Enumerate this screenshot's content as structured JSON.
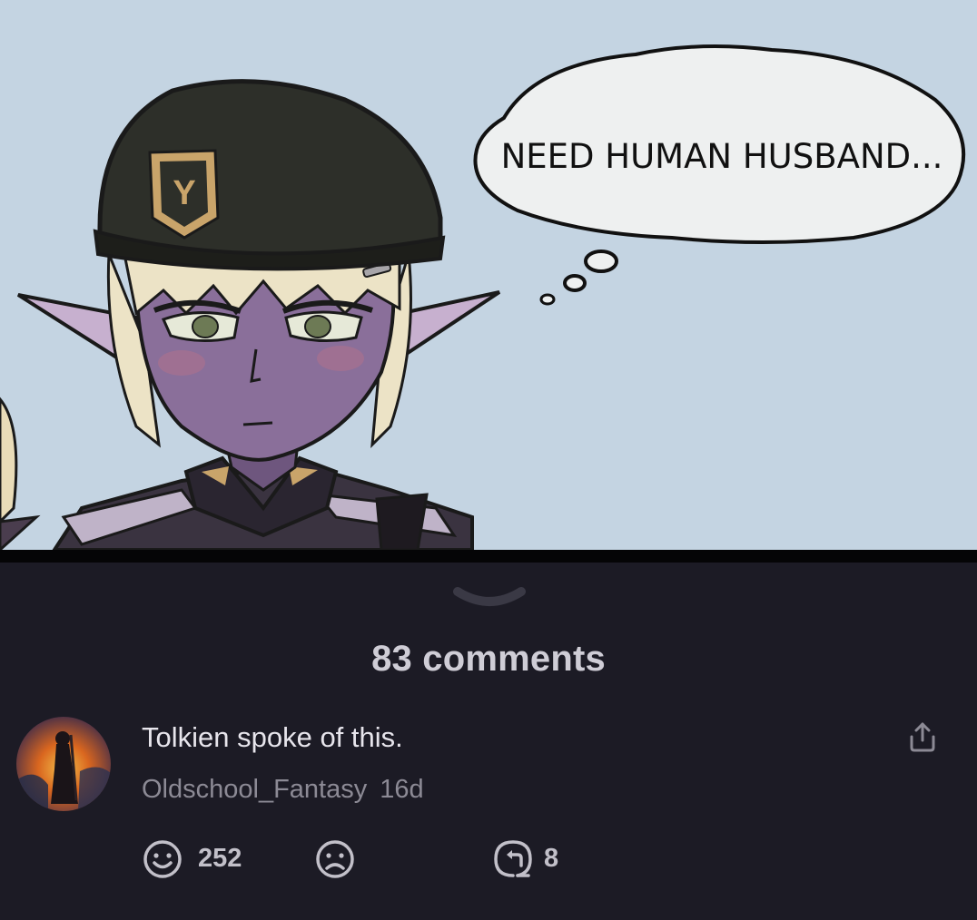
{
  "comic": {
    "thought_bubble_text": "NEED HUMAN HUSBAND..."
  },
  "comments": {
    "count_label": "83 comments"
  },
  "comment": {
    "text": "Tolkien spoke of this.",
    "username": "Oldschool_Fantasy",
    "time": "16d",
    "upvotes": "252",
    "replies": "8"
  },
  "icons": {
    "handle": "chevron-down-icon",
    "share": "share-icon",
    "upvote": "smile-icon",
    "downvote": "frown-icon",
    "reply": "reply-icon"
  },
  "colors": {
    "panel_bg": "#1c1b25",
    "comic_bg": "#c4d4e2",
    "text_primary": "#e7e5ec",
    "text_secondary": "#8c8a95"
  }
}
